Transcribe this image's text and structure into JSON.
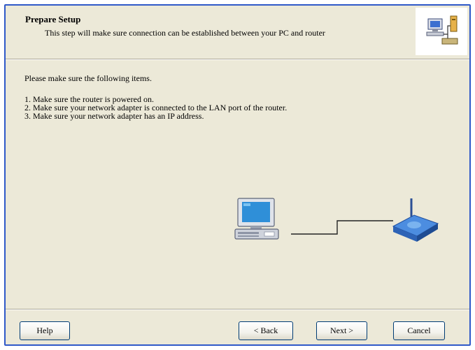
{
  "header": {
    "title": "Prepare Setup",
    "subtitle": "This step will make sure connection can be established between your PC and router",
    "icon": "network-setup-icon"
  },
  "body": {
    "intro": "Please make sure the following items.",
    "items": [
      "1. Make sure the router is powered on.",
      "2. Make sure your network adapter is connected to the LAN port of the router.",
      "3. Make sure your network adapter has an IP address."
    ],
    "illustration": {
      "computer_icon": "computer-icon",
      "router_icon": "router-icon"
    }
  },
  "buttons": {
    "help": "Help",
    "back": "< Back",
    "next": "Next >",
    "cancel": "Cancel"
  },
  "colors": {
    "dialog_background": "#ece9d8",
    "window_border": "#2f59c8",
    "button_border": "#003c74"
  }
}
